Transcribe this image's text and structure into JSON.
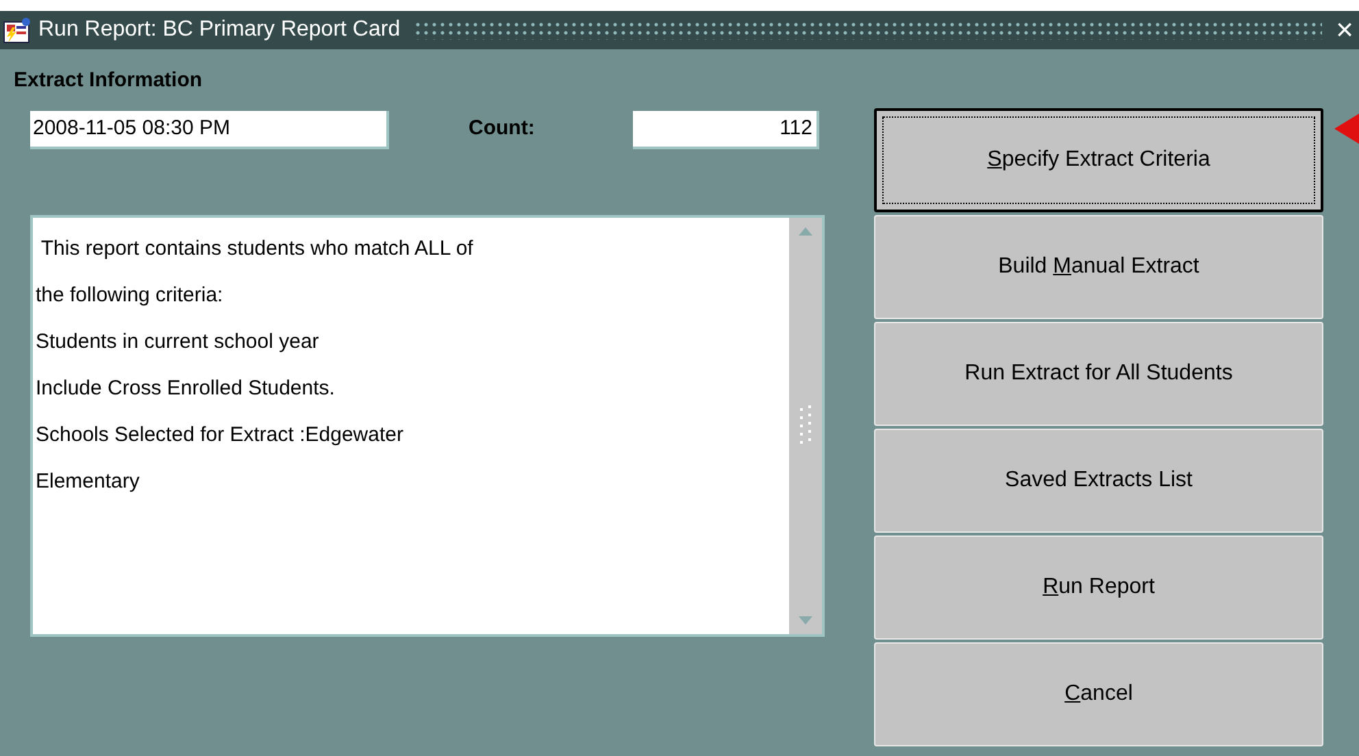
{
  "window": {
    "title": "Run Report: BC Primary Report Card",
    "close": "×"
  },
  "section_title": "Extract Information",
  "date_field": {
    "value": "2008-11-05 08:30 PM"
  },
  "count": {
    "label": "Count:",
    "value": "112"
  },
  "criteria_lines": [
    " This report contains students who match ALL of",
    "the following criteria:",
    "Students in current school year",
    "Include Cross Enrolled Students.",
    "Schools Selected for Extract :Edgewater",
    "Elementary"
  ],
  "buttons": [
    {
      "mnemonic": "S",
      "label_after": "pecify Extract Criteria",
      "focused": true
    },
    {
      "label_before": "Build ",
      "mnemonic": "M",
      "label_after": "anual Extract",
      "focused": false
    },
    {
      "label_before": "Run Extract for All Students",
      "focused": false
    },
    {
      "label_before": "Saved Extracts List",
      "focused": false
    },
    {
      "mnemonic": "R",
      "label_after": "un Report",
      "focused": false
    },
    {
      "mnemonic": "C",
      "label_after": "ancel",
      "focused": false
    }
  ]
}
